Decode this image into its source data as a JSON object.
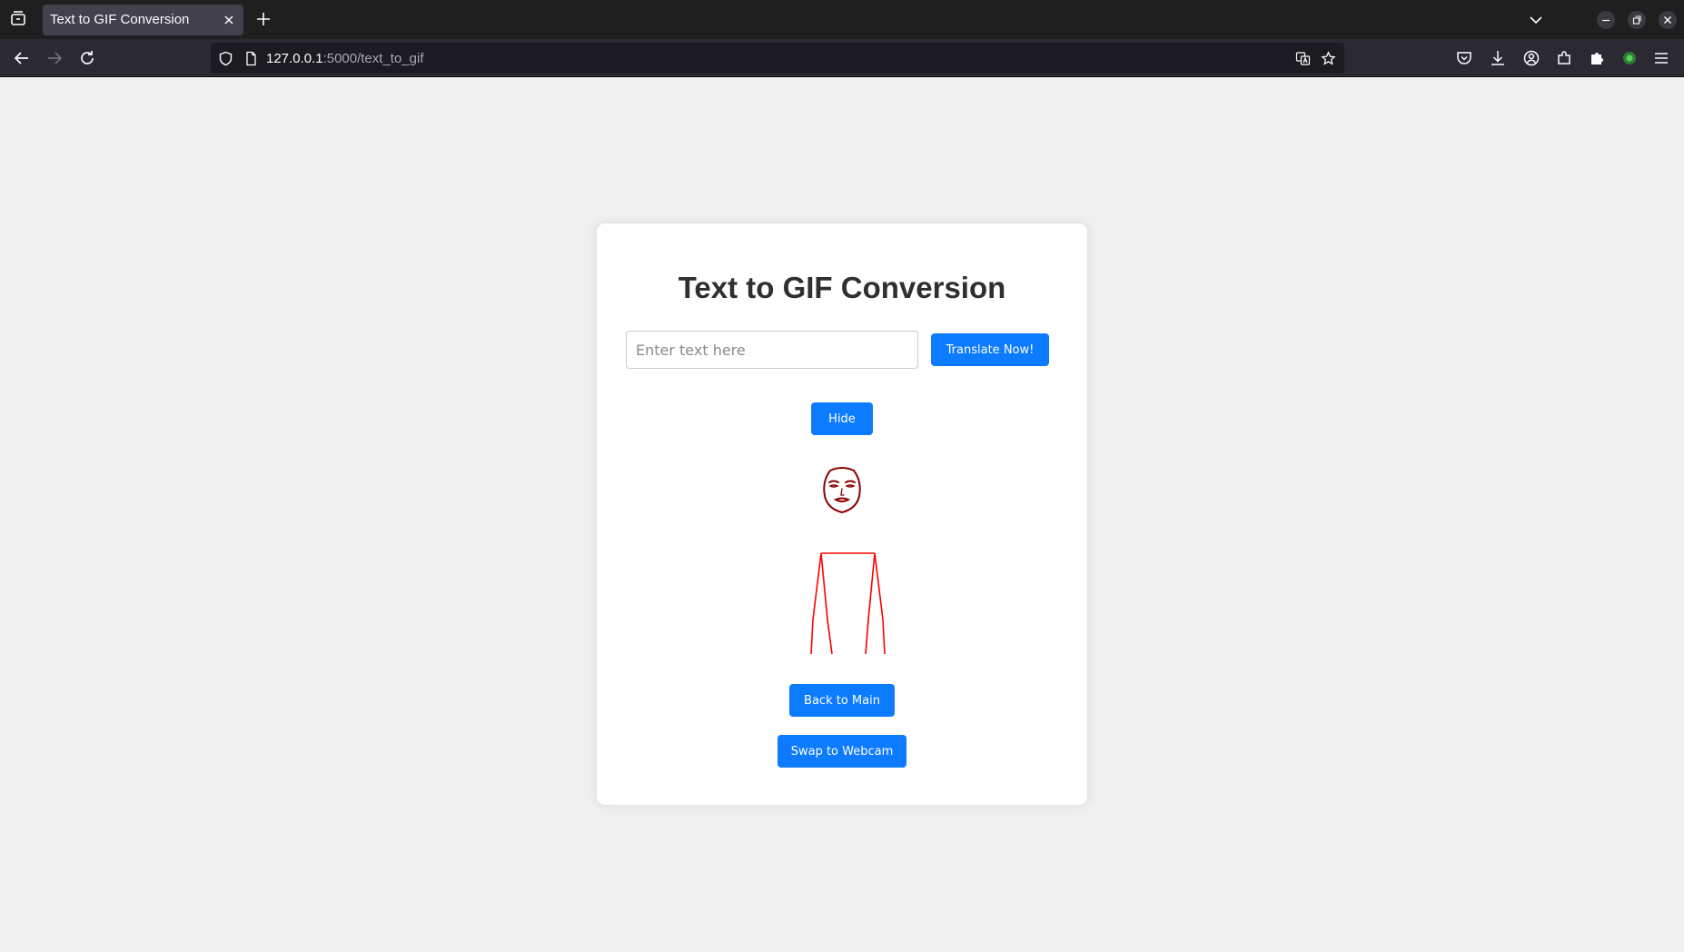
{
  "browser": {
    "tab_title": "Text to GIF Conversion",
    "url_host": "127.0.0.1",
    "url_rest": ":5000/text_to_gif"
  },
  "icons": [
    "tab-list-icon",
    "close-icon",
    "plus-icon",
    "chevron-down-icon",
    "minimize-icon",
    "restore-icon",
    "close-window-icon",
    "back-arrow-icon",
    "forward-arrow-icon",
    "reload-icon",
    "shield-icon",
    "page-icon",
    "translate-icon",
    "star-icon",
    "pocket-icon",
    "download-icon",
    "account-icon",
    "extensions-icon",
    "puzzle-icon",
    "status-dot-icon",
    "menu-icon"
  ],
  "colors": {
    "accent": "#0d7bff",
    "figure_face": "#8b0000",
    "figure_body": "#ff0000"
  },
  "page": {
    "title": "Text to GIF Conversion",
    "input_placeholder": "Enter text here",
    "input_value": "",
    "translate_button": "Translate Now!",
    "hide_button": "Hide",
    "back_button": "Back to Main",
    "swap_button": "Swap to Webcam"
  }
}
